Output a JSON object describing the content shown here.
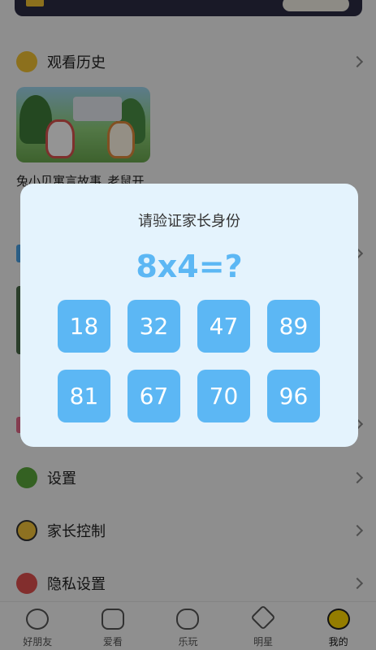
{
  "history": {
    "title": "观看历史",
    "items": [
      {
        "caption_line1": "兔小贝寓言故事_老鼠开"
      }
    ]
  },
  "menu": {
    "settings": "设置",
    "parental_control": "家长控制",
    "privacy": "隐私设置"
  },
  "bottom_nav": {
    "items": [
      {
        "label": "好朋友",
        "icon": "chat-bubble-icon"
      },
      {
        "label": "爱看",
        "icon": "tv-icon"
      },
      {
        "label": "乐玩",
        "icon": "gamepad-icon"
      },
      {
        "label": "明星",
        "icon": "star-icon"
      },
      {
        "label": "我的",
        "icon": "chick-face-icon"
      }
    ],
    "active": "我的"
  },
  "verify_dialog": {
    "title": "请验证家长身份",
    "question": "8x4=?",
    "options": [
      "18",
      "32",
      "47",
      "89",
      "81",
      "67",
      "70",
      "96"
    ]
  },
  "colors": {
    "accent_blue": "#5cb7f4",
    "dialog_bg": "#e4f3fd",
    "history_icon": "#f1c232",
    "settings_icon": "#5aa83c",
    "privacy_icon": "#e0504f"
  }
}
